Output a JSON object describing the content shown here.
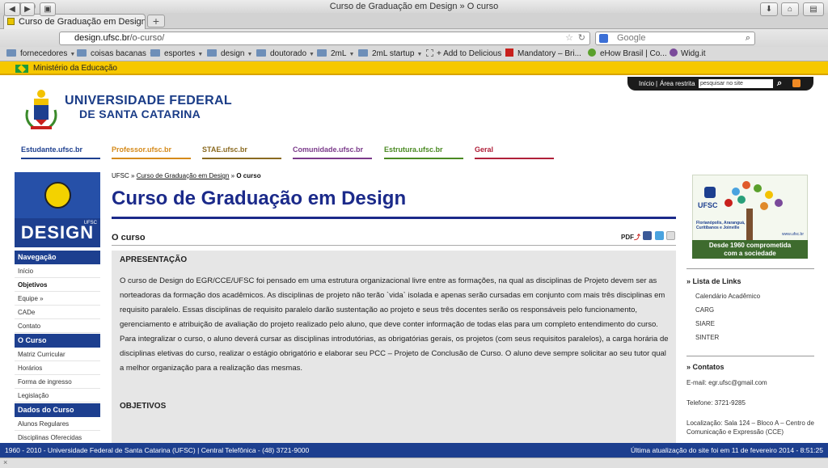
{
  "browser": {
    "window_title": "Curso de Graduação em Design » O curso",
    "tab_title": "Curso de Graduação em Design ...",
    "url_host": "design.ufsc.br",
    "url_path": "/o-curso/",
    "search_placeholder": "Google",
    "bookmarks": [
      "fornecedores",
      "coisas bacanas",
      "esportes",
      "design",
      "doutorado",
      "2mL",
      "2mL startup",
      "+ Add to Delicious",
      "Mandatory – Bri...",
      "eHow Brasil | Co...",
      "Widg.it"
    ]
  },
  "gov_bar": {
    "label": "Ministério da Educação"
  },
  "top_links": {
    "home": "Início",
    "sep": "|",
    "restricted": "Área restrita",
    "search_placeholder": "pesquisar no site"
  },
  "header": {
    "line1": "UNIVERSIDADE FEDERAL",
    "line2": "DE SANTA CATARINA"
  },
  "sections": [
    {
      "label": "Estudante.ufsc.br",
      "color": "#1d3f8f"
    },
    {
      "label": "Professor.ufsc.br",
      "color": "#d58a1a"
    },
    {
      "label": "STAE.ufsc.br",
      "color": "#8a6a20"
    },
    {
      "label": "Comunidade.ufsc.br",
      "color": "#7a3a8a"
    },
    {
      "label": "Estrutura.ufsc.br",
      "color": "#4a8a22"
    },
    {
      "label": "Geral",
      "color": "#b0203a"
    }
  ],
  "design_logo": {
    "small": "UFSC",
    "text": "DESIGN"
  },
  "sidebar": {
    "nav_head": "Navegação",
    "nav_items": [
      "Início",
      "Objetivos",
      "Equipe »",
      "CADe",
      "Contato"
    ],
    "curso_head": "O Curso",
    "curso_items": [
      "Matriz Curricular",
      "Horários",
      "Forma de ingresso",
      "Legislação"
    ],
    "dados_head": "Dados do Curso",
    "dados_items": [
      "Alunos Regulares",
      "Disciplinas Oferecidas"
    ]
  },
  "breadcrumb": {
    "root": "UFSC",
    "sep": "»",
    "parent": "Curso de Graduação em Design",
    "current": "O curso"
  },
  "main": {
    "title": "Curso de Graduação em Design",
    "subtitle": "O curso",
    "pdf_label": "PDF",
    "heading1": "APRESENTAÇÃO",
    "paragraph": "O curso de Design do EGR/CCE/UFSC foi pensado em uma estrutura organizacional livre entre as formações, na qual as disciplinas de Projeto devem ser as norteadoras da formação dos acadêmicos. As disciplinas de projeto não terão `vida` isolada e apenas serão cursadas em conjunto com mais três disciplinas em requisito paralelo. Essas disciplinas de requisito paralelo darão sustentação ao projeto e seus três docentes serão os responsáveis pelo funcionamento, gerenciamento e atribuição de avaliação do projeto realizado pelo aluno, que deve conter informação de todas elas para um completo entendimento do curso. Para integralizar o curso, o aluno deverá cursar as disciplinas introdutórias, as obrigatórias gerais, os projetos (com seus requisitos paralelos), a carga horária de disciplinas eletivas do curso, realizar o estágio obrigatório e elaborar seu PCC – Projeto de Conclusão de Curso. O aluno deve sempre solicitar ao seu tutor qual a melhor organização para a realização das mesmas.",
    "heading2": "OBJETIVOS"
  },
  "banner": {
    "line1": "Desde 1960 comprometida",
    "line2": "com a sociedade",
    "brand": "UFSC",
    "site": "www.ufsc.br",
    "campuses": "Florianópolis, Araranguá, Curitibanos e Joinville"
  },
  "right": {
    "links_head": "Lista de Links",
    "links": [
      "Calendário Acadêmico",
      "CARG",
      "SIARE",
      "SINTER"
    ],
    "contacts_head": "Contatos",
    "email": "E-mail: egr.ufsc@gmail.com",
    "phone": "Telefone: 3721-9285",
    "location": "Localização: Sala 124 – Bloco A – Centro de Comunicação e Expressão (CCE)"
  },
  "footer": {
    "left": "1960 - 2010 - Universidade Federal de Santa Catarina (UFSC) | Central Telefônica - (48) 3721-9000",
    "right": "Última atualização do site foi em 11 de fevereiro 2014 - 8:51:25"
  }
}
